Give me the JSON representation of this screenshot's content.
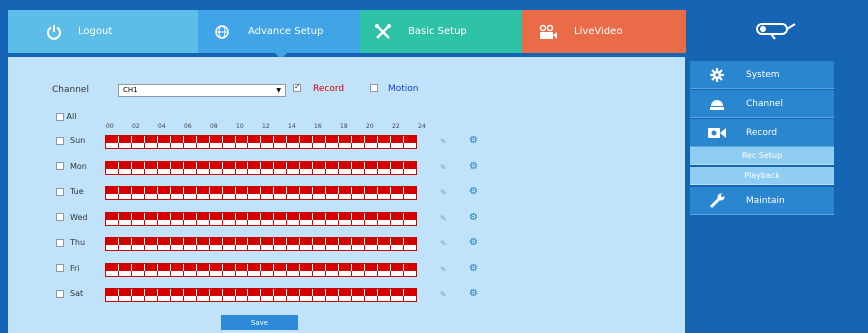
{
  "tabs": {
    "logout": "Logout",
    "advance": "Advance Setup",
    "basic": "Basic Setup",
    "live": "LiveVideo"
  },
  "channel_row": {
    "label": "Channel",
    "selected": "CH1",
    "record_label": "Record",
    "record_checked": true,
    "motion_label": "Motion",
    "motion_checked": false
  },
  "schedule": {
    "all_label": "All",
    "hours": [
      "00",
      "02",
      "04",
      "06",
      "08",
      "10",
      "12",
      "14",
      "16",
      "18",
      "20",
      "22",
      "24"
    ],
    "days": [
      "Sun",
      "Mon",
      "Tue",
      "Wed",
      "Thu",
      "Fri",
      "Sat"
    ]
  },
  "save_label": "Save",
  "sidebar": {
    "system": "System",
    "channel": "Channel",
    "record": "Record",
    "rec_setup": "Rec Setup",
    "playback": "Playback",
    "maintain": "Maintain"
  },
  "colors": {
    "record_red": "#d50000",
    "motion_blue": "#1a3fd0"
  }
}
